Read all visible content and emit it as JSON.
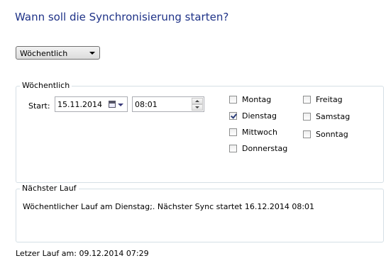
{
  "heading": "Wann soll die Synchronisierung starten?",
  "frequency": {
    "selected": "Wöchentlich"
  },
  "weekly_group": {
    "legend": "Wöchentlich",
    "start_label": "Start:",
    "date_value": "15.11.2014",
    "time_value": "08:01",
    "days": [
      {
        "label": "Montag",
        "checked": false
      },
      {
        "label": "Dienstag",
        "checked": true
      },
      {
        "label": "Mittwoch",
        "checked": false
      },
      {
        "label": "Donnerstag",
        "checked": false
      },
      {
        "label": "Freitag",
        "checked": false
      },
      {
        "label": "Samstag",
        "checked": false
      },
      {
        "label": "Sonntag",
        "checked": false
      }
    ]
  },
  "next_run": {
    "legend": "Nächster Lauf",
    "text": "Wöchentlicher Lauf am Dienstag;.  Nächster Sync startet 16.12.2014 08:01"
  },
  "last_run": "Letzer Lauf am: 09.12.2014 07:29",
  "colors": {
    "heading": "#1e3287",
    "group_border": "#d5dfe5"
  }
}
